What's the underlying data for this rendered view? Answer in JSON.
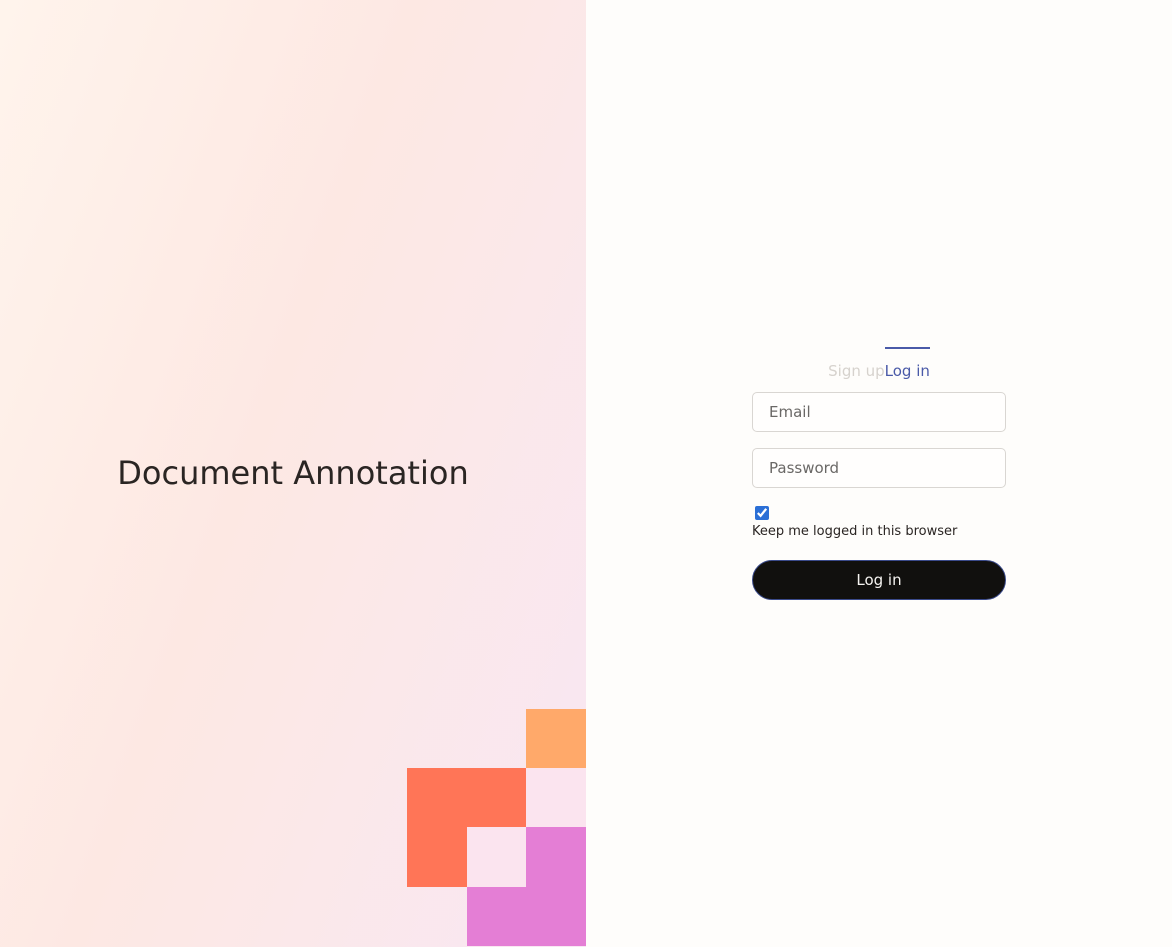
{
  "brand": {
    "title": "Document Annotation"
  },
  "auth": {
    "tabs": [
      {
        "label": "Sign up",
        "active": false
      },
      {
        "label": "Log in",
        "active": true
      }
    ],
    "email": {
      "placeholder": "Email",
      "value": ""
    },
    "password": {
      "placeholder": "Password",
      "value": ""
    },
    "remember": {
      "label": "Keep me logged in this browser",
      "checked": true
    },
    "submit_label": "Log in"
  },
  "colors": {
    "accent": "#4a5aa8",
    "button_bg": "#11100e",
    "tile_orange": "#ffa96a",
    "tile_coral": "#ff7557",
    "tile_pink": "#e47ed5"
  }
}
